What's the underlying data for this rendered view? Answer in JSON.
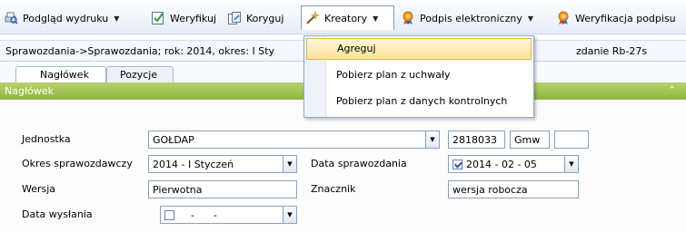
{
  "toolbar": {
    "items": [
      {
        "label": "Podgląd wydruku",
        "icon": "print-preview-icon"
      },
      {
        "label": "Weryfikuj",
        "icon": "verify-check-icon"
      },
      {
        "label": "Koryguj",
        "icon": "correct-icon"
      },
      {
        "label": "Kreatory",
        "icon": "wizard-icon"
      },
      {
        "label": "Podpis elektroniczny",
        "icon": "signature-icon"
      },
      {
        "label": "Weryfikacja podpisu",
        "icon": "signature-verify-icon"
      }
    ]
  },
  "pathbar": {
    "text": "Sprawozdania->Sprawozdania; rok: 2014, okres: I Sty",
    "right_text": "zdanie Rb-27s"
  },
  "tabs": [
    {
      "label": "Nagłówek",
      "active": true
    },
    {
      "label": "Pozycje",
      "active": false
    }
  ],
  "section": {
    "title": "Nagłówek"
  },
  "form": {
    "jednostka": {
      "label": "Jednostka",
      "value": "GOŁDAP",
      "code": "2818033",
      "type": "Gmw",
      "extra": ""
    },
    "okres": {
      "label": "Okres sprawozdawczy",
      "value": "2014 - I Styczeń"
    },
    "data_sprawozdania": {
      "label": "Data sprawozdania",
      "value": "2014  -  02  -  05",
      "checked": true
    },
    "wersja": {
      "label": "Wersja",
      "value": "Pierwotna"
    },
    "znacznik": {
      "label": "Znacznik",
      "value": "wersja robocza"
    },
    "data_wyslania": {
      "label": "Data wysłania",
      "value": "    -      -",
      "checked": false
    }
  },
  "menu": {
    "items": [
      {
        "label": "Agreguj",
        "highlighted": true
      },
      {
        "label": "Pobierz plan z uchwały",
        "highlighted": false
      },
      {
        "label": "Pobierz plan z danych kontrolnych",
        "highlighted": false
      }
    ]
  },
  "colors": {
    "section_header": "#9dc14d",
    "menu_highlight": "#ffe9a8",
    "toolbar_bg": "#eaf0f8"
  }
}
